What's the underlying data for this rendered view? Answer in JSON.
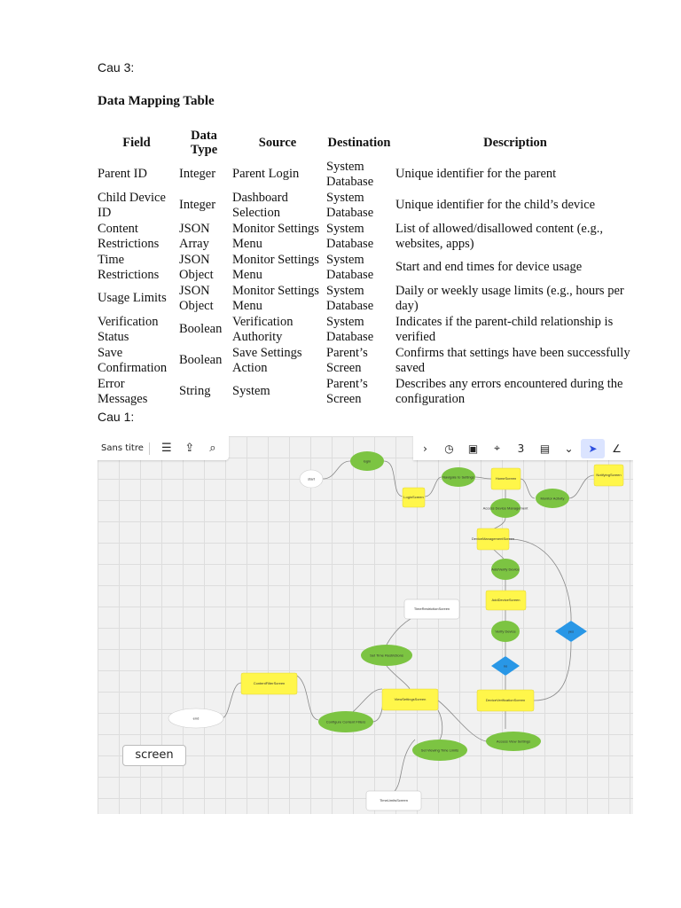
{
  "heading_cau3": "Cau 3:",
  "table_title": "Data Mapping Table",
  "table": {
    "headers": {
      "field": "Field",
      "data_type": "Data Type",
      "source": "Source",
      "destination": "Destination",
      "description": "Description"
    },
    "rows": [
      {
        "field": "Parent ID",
        "data_type": "Integer",
        "source": "Parent Login",
        "destination": "System Database",
        "description": "Unique identifier for the parent"
      },
      {
        "field": "Child Device ID",
        "data_type": "Integer",
        "source": "Dashboard Selection",
        "destination": "System Database",
        "description": "Unique identifier for the child’s device"
      },
      {
        "field": "Content Restrictions",
        "data_type": "JSON Array",
        "source": "Monitor Settings Menu",
        "destination": "System Database",
        "description": "List of allowed/disallowed content (e.g., websites, apps)"
      },
      {
        "field": "Time Restrictions",
        "data_type": "JSON Object",
        "source": "Monitor Settings Menu",
        "destination": "System Database",
        "description": "Start and end times for device usage"
      },
      {
        "field": "Usage Limits",
        "data_type": "JSON Object",
        "source": "Monitor Settings Menu",
        "destination": "System Database",
        "description": "Daily or weekly usage limits (e.g., hours per day)"
      },
      {
        "field": "Verification Status",
        "data_type": "Boolean",
        "source": "Verification Authority",
        "destination": "System Database",
        "description": "Indicates if the parent-child relationship is verified"
      },
      {
        "field": "Save Confirmation",
        "data_type": "Boolean",
        "source": "Save Settings Action",
        "destination": "Parent’s Screen",
        "description": "Confirms that settings have been successfully saved"
      },
      {
        "field": "Error Messages",
        "data_type": "String",
        "source": "System",
        "destination": "Parent’s Screen",
        "description": "Describes any errors encountered during the configuration"
      }
    ]
  },
  "heading_cau1": "Cau 1:",
  "board": {
    "name": "Sans titre",
    "screen_badge": "screen",
    "colors": {
      "screen_node": "#fff64a",
      "action_node": "#7cc442",
      "decision_node": "#2997e6",
      "terminal_node": "#ffffff",
      "edge": "#888888"
    },
    "left_tools": [
      "menu-icon",
      "share-icon",
      "search-icon"
    ],
    "right_tools": [
      "chevron-right-icon",
      "timer-icon",
      "card-icon",
      "focus-icon",
      "counter-icon",
      "notes-icon",
      "more-icon",
      "cursor-icon",
      "pen-icon"
    ],
    "right_tool_glyphs": [
      "›",
      "◷",
      "▣",
      "⌖",
      "3",
      "▤",
      "⌄",
      "➤",
      "∠"
    ],
    "nodes": [
      {
        "id": "start",
        "label": "start",
        "shape": "terminal"
      },
      {
        "id": "login",
        "label": "login",
        "shape": "action"
      },
      {
        "id": "loginscreen",
        "label": "LoginScreen",
        "shape": "screen"
      },
      {
        "id": "navigate",
        "label": "Navigate to Settings",
        "shape": "action"
      },
      {
        "id": "homescreen",
        "label": "HomeScreen",
        "shape": "screen"
      },
      {
        "id": "monitor",
        "label": "Monitor Activity",
        "shape": "action"
      },
      {
        "id": "notifying",
        "label": "NotifyingScreen",
        "shape": "screen"
      },
      {
        "id": "access",
        "label": "Access Device Management",
        "shape": "action"
      },
      {
        "id": "devmgmt",
        "label": "DeviceManagementScreen",
        "shape": "screen"
      },
      {
        "id": "addverify",
        "label": "Add/Verify Device",
        "shape": "action"
      },
      {
        "id": "adddevice",
        "label": "AddDeviceScreen",
        "shape": "screen"
      },
      {
        "id": "verifydevice",
        "label": "Verify Device",
        "shape": "action"
      },
      {
        "id": "timerestr",
        "label": "TimeRestrictionScreen",
        "shape": "terminal"
      },
      {
        "id": "settime",
        "label": "Set Time Restrictions",
        "shape": "action"
      },
      {
        "id": "decision1",
        "label": "yes",
        "shape": "decision"
      },
      {
        "id": "decision2",
        "label": "no",
        "shape": "decision"
      },
      {
        "id": "contentfilter",
        "label": "ContentFilterScreen",
        "shape": "screen"
      },
      {
        "id": "viewsettings",
        "label": "ViewSettingsScreen",
        "shape": "screen"
      },
      {
        "id": "devverify",
        "label": "DeviceVerificationScreen",
        "shape": "screen"
      },
      {
        "id": "end",
        "label": "end",
        "shape": "terminal"
      },
      {
        "id": "configure",
        "label": "Configure Content Filters",
        "shape": "action"
      },
      {
        "id": "accessview",
        "label": "Access View Settings",
        "shape": "action"
      },
      {
        "id": "setviewing",
        "label": "Set Viewing Time Limits",
        "shape": "action"
      },
      {
        "id": "timelimits",
        "label": "TimeLimitsScreen",
        "shape": "terminal"
      }
    ]
  }
}
